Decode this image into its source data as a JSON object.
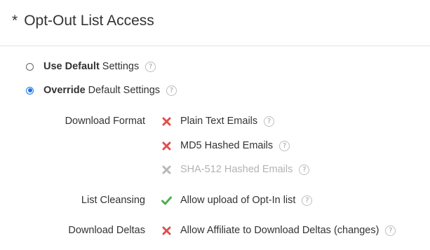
{
  "section": {
    "asterisk": "*",
    "title": "Opt-Out List Access"
  },
  "mode": {
    "use_default": {
      "bold": "Use Default",
      "rest": " Settings",
      "selected": false
    },
    "override": {
      "bold": "Override",
      "rest": " Default Settings",
      "selected": true
    },
    "help_glyph": "?"
  },
  "settings": {
    "download_format": {
      "label": "Download Format",
      "options": [
        {
          "label": "Plain Text Emails",
          "status": "x-icon",
          "enabled": true
        },
        {
          "label": "MD5 Hashed Emails",
          "status": "x-icon",
          "enabled": true
        },
        {
          "label": "SHA-512 Hashed Emails",
          "status": "x-icon",
          "enabled": false
        }
      ]
    },
    "list_cleansing": {
      "label": "List Cleansing",
      "options": [
        {
          "label": "Allow upload of Opt-In list",
          "status": "check-icon",
          "enabled": true
        }
      ]
    },
    "download_deltas": {
      "label": "Download Deltas",
      "options": [
        {
          "label": "Allow Affiliate to Download Deltas (changes)",
          "status": "x-icon",
          "enabled": true
        }
      ]
    }
  },
  "colors": {
    "x_active": "#e04f4f",
    "x_disabled": "#b8b8b8",
    "check": "#4caf50",
    "radio_selected": "#1a73e8"
  }
}
